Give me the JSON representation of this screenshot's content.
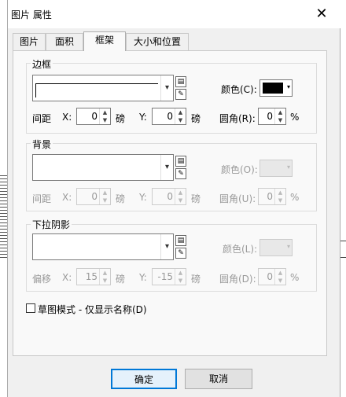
{
  "window": {
    "title": "图片 属性",
    "close_glyph": "✕"
  },
  "tabs": [
    {
      "label": "图片",
      "active": false
    },
    {
      "label": "面积",
      "active": false
    },
    {
      "label": "框架",
      "active": true
    },
    {
      "label": "大小和位置",
      "active": false
    }
  ],
  "border": {
    "title": "边框",
    "color_label": "颜色(C):",
    "color_value": "#000000",
    "spacing_label": "间距",
    "x_label": "X:",
    "x_value": "0",
    "x_unit": "磅",
    "y_label": "Y:",
    "y_value": "0",
    "y_unit": "磅",
    "radius_label": "圆角(R):",
    "radius_value": "0",
    "radius_unit": "%"
  },
  "background": {
    "title": "背景",
    "color_label": "颜色(O):",
    "spacing_label": "间距",
    "x_label": "X:",
    "x_value": "0",
    "x_unit": "磅",
    "y_label": "Y:",
    "y_value": "0",
    "y_unit": "磅",
    "radius_label": "圆角(U):",
    "radius_value": "0",
    "radius_unit": "%"
  },
  "shadow": {
    "title": "下拉阴影",
    "color_label": "颜色(L):",
    "offset_label": "偏移",
    "x_label": "X:",
    "x_value": "15",
    "x_unit": "磅",
    "y_label": "Y:",
    "y_value": "-15",
    "y_unit": "磅",
    "radius_label": "圆角(D):",
    "radius_value": "0",
    "radius_unit": "%"
  },
  "draft_mode": {
    "label": "草图模式 - 仅显示名称(D)",
    "checked": false
  },
  "buttons": {
    "ok": "确定",
    "cancel": "取消"
  },
  "icons": {
    "dropdown": "▾",
    "spin_up": "▲",
    "spin_down": "▼",
    "edit_list": "▤",
    "edit_pen": "✎"
  },
  "background_app": {
    "right_marks": "× ×"
  }
}
